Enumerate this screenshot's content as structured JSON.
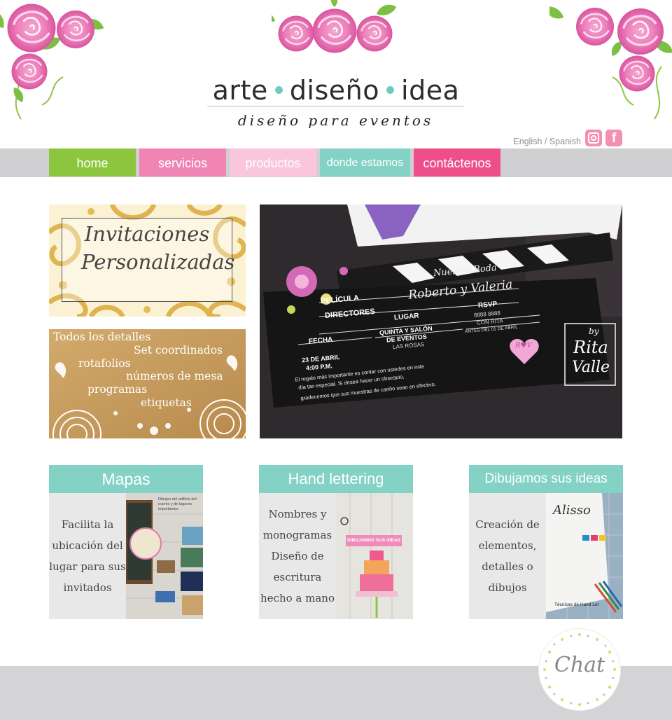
{
  "logo": {
    "word1": "arte",
    "word2": "diseño",
    "word3": "idea",
    "tagline": "diseño para eventos"
  },
  "lang": {
    "text": "English / Spanish"
  },
  "social": {
    "instagram": "instagram-icon",
    "facebook": "facebook-icon",
    "f_glyph": "f"
  },
  "nav": [
    {
      "label": "home",
      "color": "#8cc63f"
    },
    {
      "label": "servicios",
      "color": "#f084b4"
    },
    {
      "label": "productos",
      "color": "#f9c6db"
    },
    {
      "label": "donde estamos",
      "color": "#84d2c5"
    },
    {
      "label": "contáctenos",
      "color": "#ee4e89"
    }
  ],
  "banners": {
    "invitaciones": {
      "line1": "Invitaciones",
      "line2": "Personalizadas"
    },
    "detalles": [
      "Todos los detalles",
      "Set coordinados",
      "rotafolios",
      "números de mesa",
      "programas",
      "etiquetas"
    ]
  },
  "photo": {
    "title_script": "Nuestra Boda",
    "names": "Roberto y Valeria",
    "pelicula": "PELÍCULA",
    "directores": "DIRECTORES",
    "lugar": "LUGAR",
    "rsvp": "RSVP",
    "rsvp_phone": "8888 8888",
    "rsvp_con": "CON RITA",
    "rsvp_antes": "ANTES DEL 01 DE ABRIL",
    "fecha": "FECHA",
    "fecha_val1": "23 DE ABRIL",
    "fecha_val2": "4:00 P.M.",
    "lugar_val1": "QUINTA Y SALÓN",
    "lugar_val2": "DE EVENTOS",
    "lugar_val3": "LAS ROSAS",
    "msg1": "El regalo más importante es contar con ustedes en este",
    "msg2": "día tan especial. Si desea hacer un obsequio,",
    "msg3": "gradecemos que sus muestras de cariño sean en efectivo.",
    "heart": "R♥V",
    "sig_by": "by",
    "sig_name1": "Rita",
    "sig_name2": "Valle"
  },
  "cards": [
    {
      "title": "Mapas",
      "text": "Facilita la ubicación del lugar para sus invitados"
    },
    {
      "title": "Hand lettering",
      "text": "Nombres y monogramas Diseño de escritura hecho a mano"
    },
    {
      "title": "Dibujamos sus ideas",
      "text": "Creación de elementos, detalles o dibujos"
    }
  ],
  "card_images": {
    "mapas_caption": "Dibujos del edificio del evento y de lugares importantes",
    "hand_sticker": "DIBUJAMOS SUS IDEAS",
    "ideas_script": "Alisso",
    "ideas_caption": "Técnicas de Hand Let"
  },
  "chat": {
    "label": "Chat"
  }
}
